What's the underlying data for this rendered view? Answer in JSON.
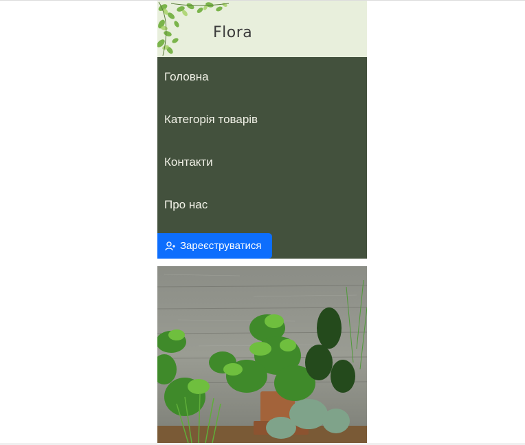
{
  "header": {
    "brand": "Flora"
  },
  "nav": {
    "items": [
      {
        "label": "Головна"
      },
      {
        "label": "Категорія товарів"
      },
      {
        "label": "Контакти"
      },
      {
        "label": "Про нас"
      }
    ],
    "register_label": "Зареєструватися"
  },
  "colors": {
    "header_bg": "#e8efdc",
    "nav_bg": "#43513d",
    "nav_text": "#f2f2e8",
    "button_bg": "#0d6efd"
  },
  "icons": {
    "register": "user-plus-icon",
    "decoration": "leaves-icon"
  }
}
